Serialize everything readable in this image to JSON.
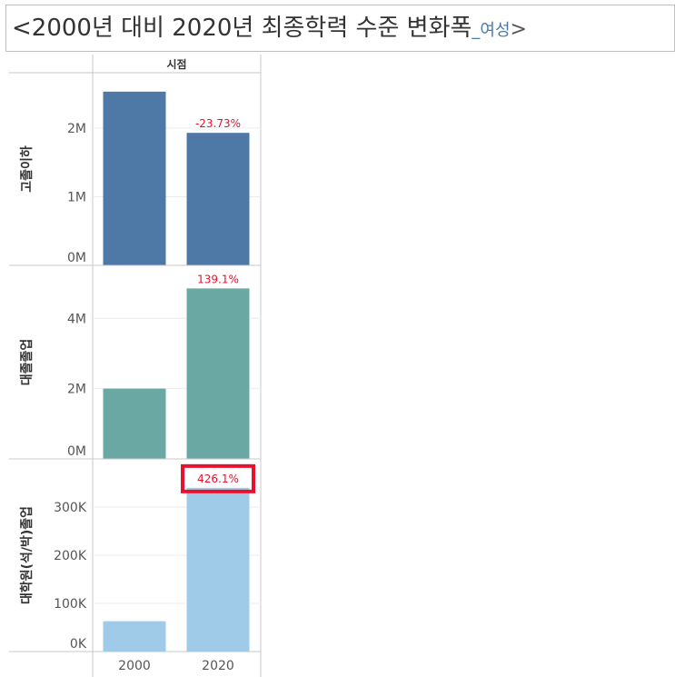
{
  "title": {
    "main": "<2000년 대비 2020년 최종학력 수준 변화폭",
    "sub": "_여성",
    "close": ">"
  },
  "chart_data": {
    "type": "bar",
    "column_header": "시점",
    "categories": [
      "2000",
      "2020"
    ],
    "panels": [
      {
        "row_label": "고졸이하",
        "color": "#4e79a7",
        "values": [
          2530000,
          1930000
        ],
        "change_label": "-23.73%",
        "ylim": [
          0,
          2700000
        ],
        "ticks": [
          {
            "v": 0,
            "label": "0M"
          },
          {
            "v": 1000000,
            "label": "1M"
          },
          {
            "v": 2000000,
            "label": "2M"
          }
        ],
        "highlight": false
      },
      {
        "row_label": "대졸졸업",
        "color": "#6aa8a3",
        "values": [
          2000000,
          4850000
        ],
        "change_label": "139.1%",
        "ylim": [
          0,
          5300000
        ],
        "ticks": [
          {
            "v": 0,
            "label": "0M"
          },
          {
            "v": 2000000,
            "label": "2M"
          },
          {
            "v": 4000000,
            "label": "4M"
          }
        ],
        "highlight": false
      },
      {
        "row_label": "대학원(석/박)졸업",
        "color": "#a0cbe8",
        "values": [
          63000,
          340000
        ],
        "change_label": "426.1%",
        "ylim": [
          0,
          385000
        ],
        "ticks": [
          {
            "v": 0,
            "label": "0K"
          },
          {
            "v": 100000,
            "label": "100K"
          },
          {
            "v": 200000,
            "label": "200K"
          },
          {
            "v": 300000,
            "label": "300K"
          }
        ],
        "highlight": true
      }
    ],
    "label_color": "#e8112d",
    "highlight_color": "#e8112d",
    "grid": true
  }
}
